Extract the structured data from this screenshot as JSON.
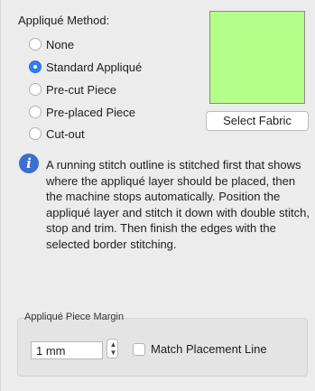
{
  "applique_method": {
    "title": "Appliqué Method:",
    "options": [
      {
        "label": "None",
        "checked": false
      },
      {
        "label": "Standard Appliqué",
        "checked": true
      },
      {
        "label": "Pre-cut Piece",
        "checked": false
      },
      {
        "label": "Pre-placed Piece",
        "checked": false
      },
      {
        "label": "Cut-out",
        "checked": false
      }
    ]
  },
  "fabric": {
    "swatch_color": "#b3ff8a",
    "select_label": "Select Fabric"
  },
  "info": {
    "icon": "info-icon",
    "icon_glyph": "i",
    "text": "A running stitch outline is stitched first that shows where the appliqué layer should be placed, then the machine stops automatically. Position the appliqué layer and stitch it down with double stitch, stop and trim. Then finish the edges with the selected border stitching."
  },
  "piece_margin": {
    "title": "Appliqué Piece Margin",
    "value": "1 mm",
    "stepper_glyph": "▲▼",
    "match_placement_label": "Match Placement Line",
    "match_placement_checked": false
  }
}
